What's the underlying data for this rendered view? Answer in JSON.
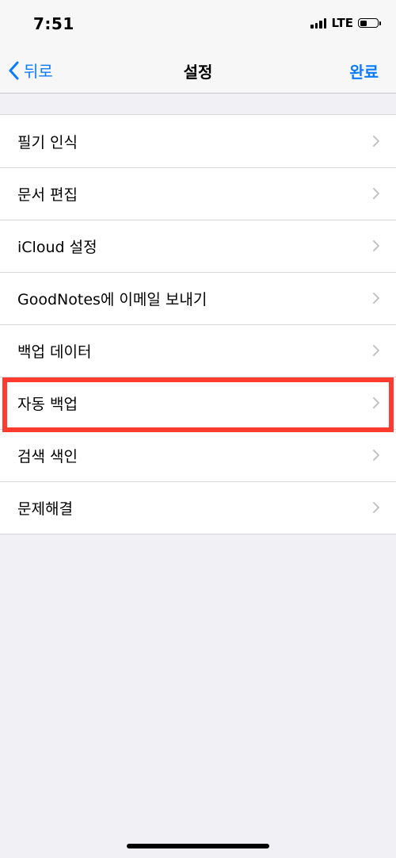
{
  "status_bar": {
    "time": "7:51",
    "network": "LTE",
    "battery_level": 0.4
  },
  "nav": {
    "back_label": "뒤로",
    "title": "설정",
    "done_label": "완료"
  },
  "settings": {
    "items": [
      {
        "label": "필기 인식",
        "icon": "chevron-right-icon"
      },
      {
        "label": "문서 편집",
        "icon": "chevron-right-icon"
      },
      {
        "label": "iCloud 설정",
        "icon": "chevron-right-icon"
      },
      {
        "label": "GoodNotes에 이메일 보내기",
        "icon": "chevron-right-icon"
      },
      {
        "label": "백업 데이터",
        "icon": "chevron-right-icon"
      },
      {
        "label": "자동 백업",
        "icon": "chevron-right-icon",
        "highlighted": true
      },
      {
        "label": "검색 색인",
        "icon": "chevron-right-icon"
      },
      {
        "label": "문제해결",
        "icon": "chevron-right-icon"
      }
    ]
  },
  "colors": {
    "accent": "#0a7cff",
    "highlight": "#ff3b30",
    "background": "#f0f0f5"
  }
}
